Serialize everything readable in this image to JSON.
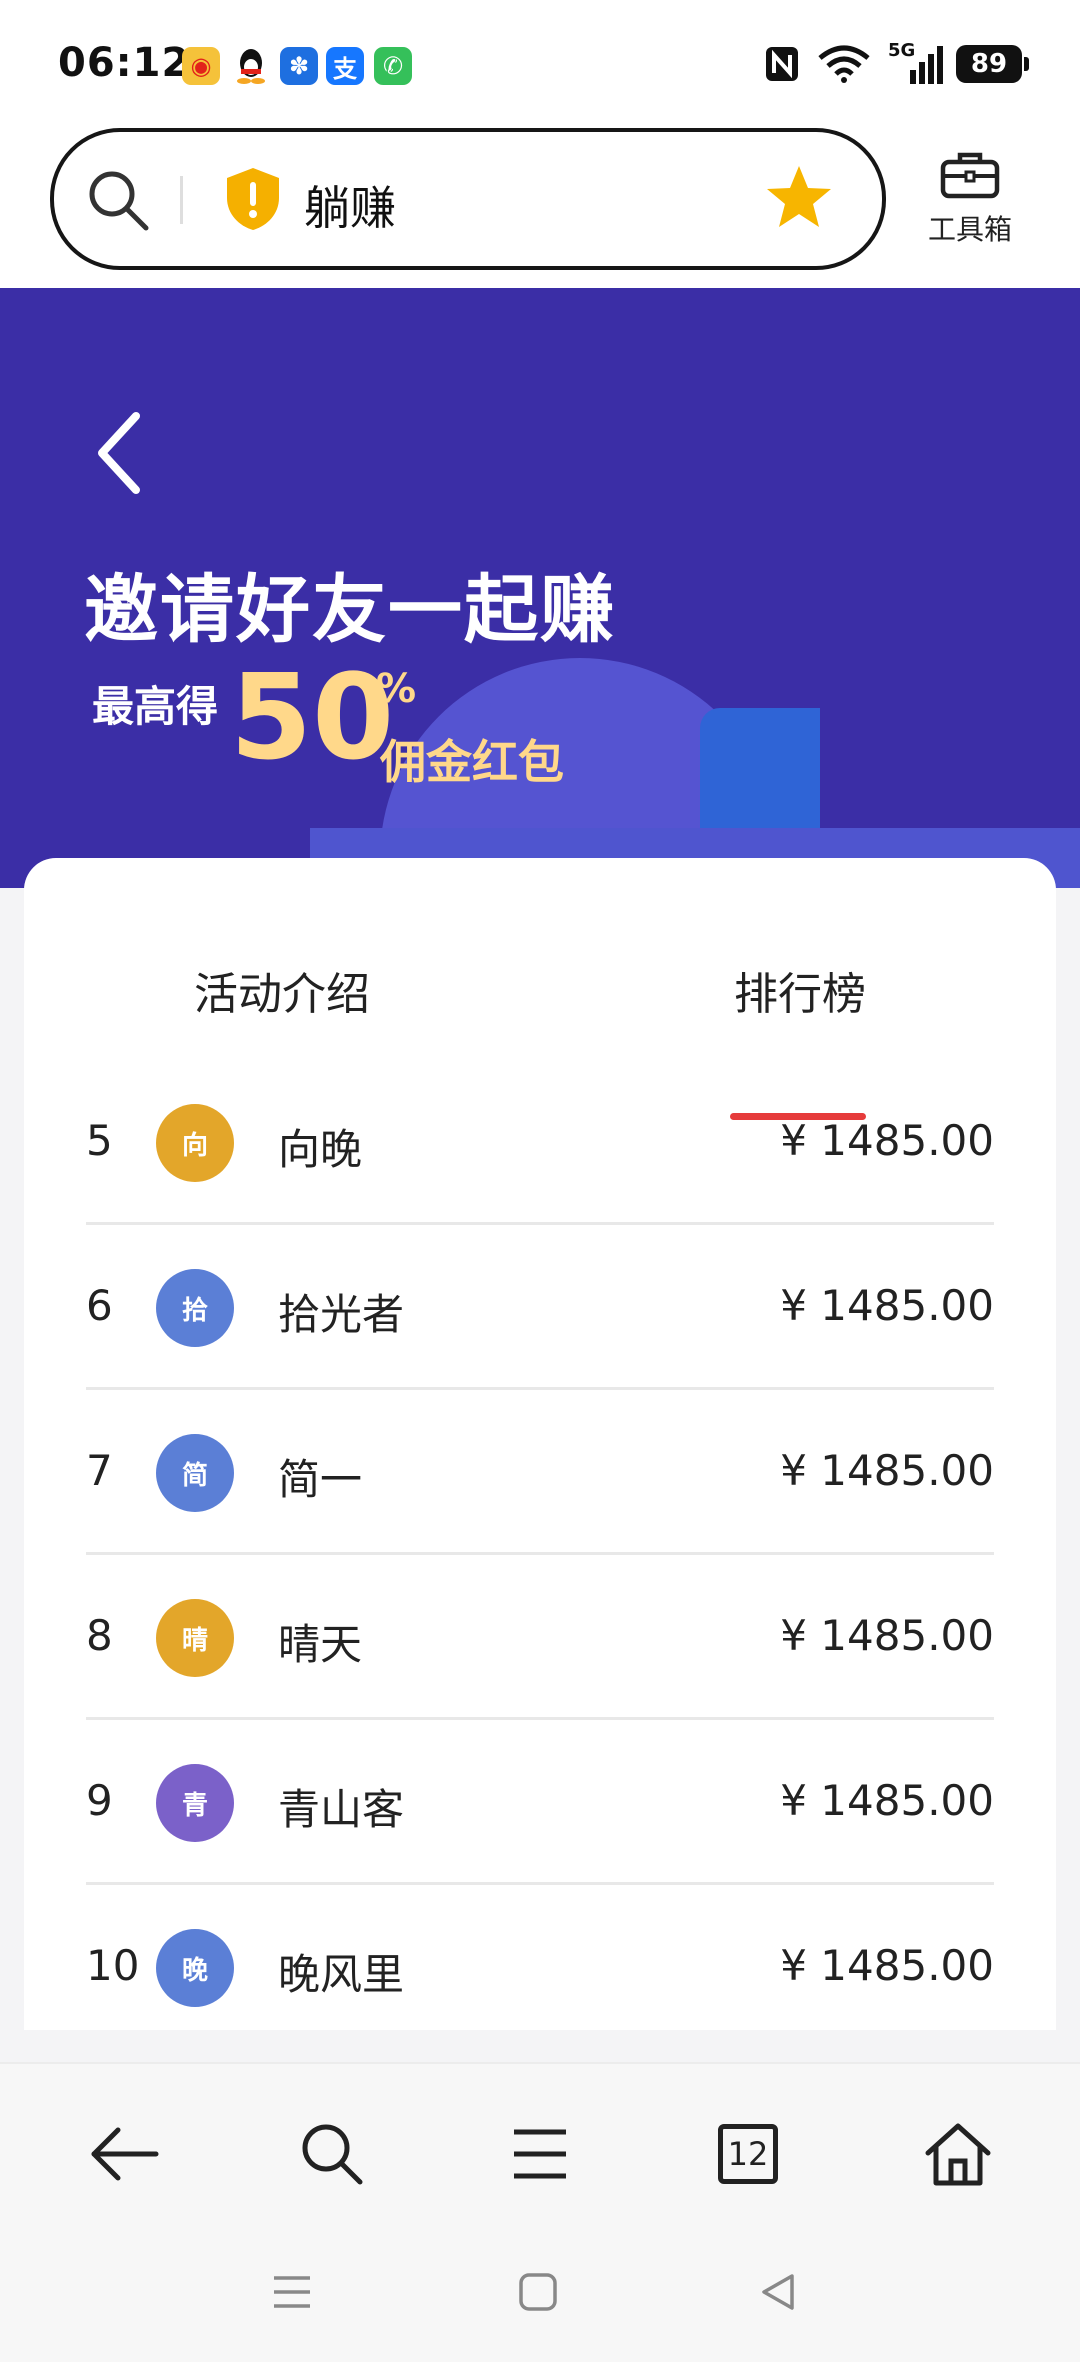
{
  "status_bar": {
    "time": "06:12",
    "signal_label": "5G",
    "battery": "89"
  },
  "browser": {
    "url_text": "躺赚",
    "toolbox_label": "工具箱"
  },
  "banner": {
    "title": "邀请好友一起赚",
    "prefix": "最高得",
    "percent_number": "50",
    "percent_sign": "%",
    "suffix": "佣金红包"
  },
  "tabs": {
    "intro": "活动介绍",
    "ranking": "排行榜"
  },
  "leaderboard": [
    {
      "rank": "5",
      "avatar": "向",
      "name": "向晚",
      "amount": "¥ 1485.00",
      "avatar_color": "#e3a62a"
    },
    {
      "rank": "6",
      "avatar": "拾",
      "name": "拾光者",
      "amount": "¥ 1485.00",
      "avatar_color": "#5b7fd6"
    },
    {
      "rank": "7",
      "avatar": "简",
      "name": "简一",
      "amount": "¥ 1485.00",
      "avatar_color": "#5b7fd6"
    },
    {
      "rank": "8",
      "avatar": "晴",
      "name": "晴天",
      "amount": "¥ 1485.00",
      "avatar_color": "#e3a62a"
    },
    {
      "rank": "9",
      "avatar": "青",
      "name": "青山客",
      "amount": "¥ 1485.00",
      "avatar_color": "#7b61c9"
    },
    {
      "rank": "10",
      "avatar": "晚",
      "name": "晚风里",
      "amount": "¥ 1485.00",
      "avatar_color": "#5b7fd6"
    }
  ],
  "bottom_nav": {
    "tabs_count": "12"
  },
  "colors": {
    "banner_bg": "#3b2ea6",
    "accent_gold": "#ffd88a",
    "tab_underline": "#e63b3b",
    "star": "#f7b500"
  }
}
